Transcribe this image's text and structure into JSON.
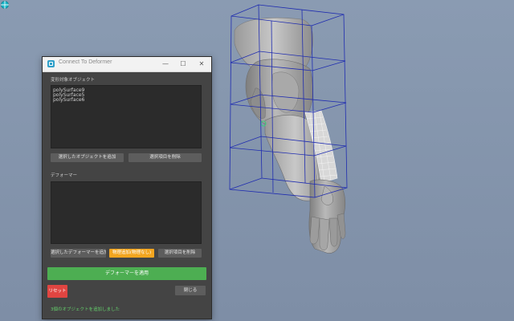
{
  "window": {
    "title": "Connect To Deformer",
    "controls": {
      "minimize": "—",
      "maximize": "☐",
      "close": "✕"
    }
  },
  "objects_section": {
    "label": "変形対象オブジェクト",
    "items": [
      "polySurface9",
      "polySurface5",
      "polySurface6"
    ],
    "add_button": "選択したオブジェクトを追加",
    "remove_button": "選択項目を削除"
  },
  "deformer_section": {
    "label": "デフォーマー",
    "items": [],
    "add_button": "選択したデフォーマーを追加",
    "auto_button": "物理追加(物理なし)",
    "remove_button": "選択項目を削除"
  },
  "apply_button": "デフォーマーを適用",
  "reset_button": "リセット",
  "close_button": "閉じる",
  "status": "3個のオブジェクトを追加しました",
  "colors": {
    "viewport_bg": "#8394ad",
    "accent_green": "#4dae52",
    "accent_orange": "#f3a51f",
    "accent_red": "#e04541",
    "lattice": "#1f2cb0"
  }
}
